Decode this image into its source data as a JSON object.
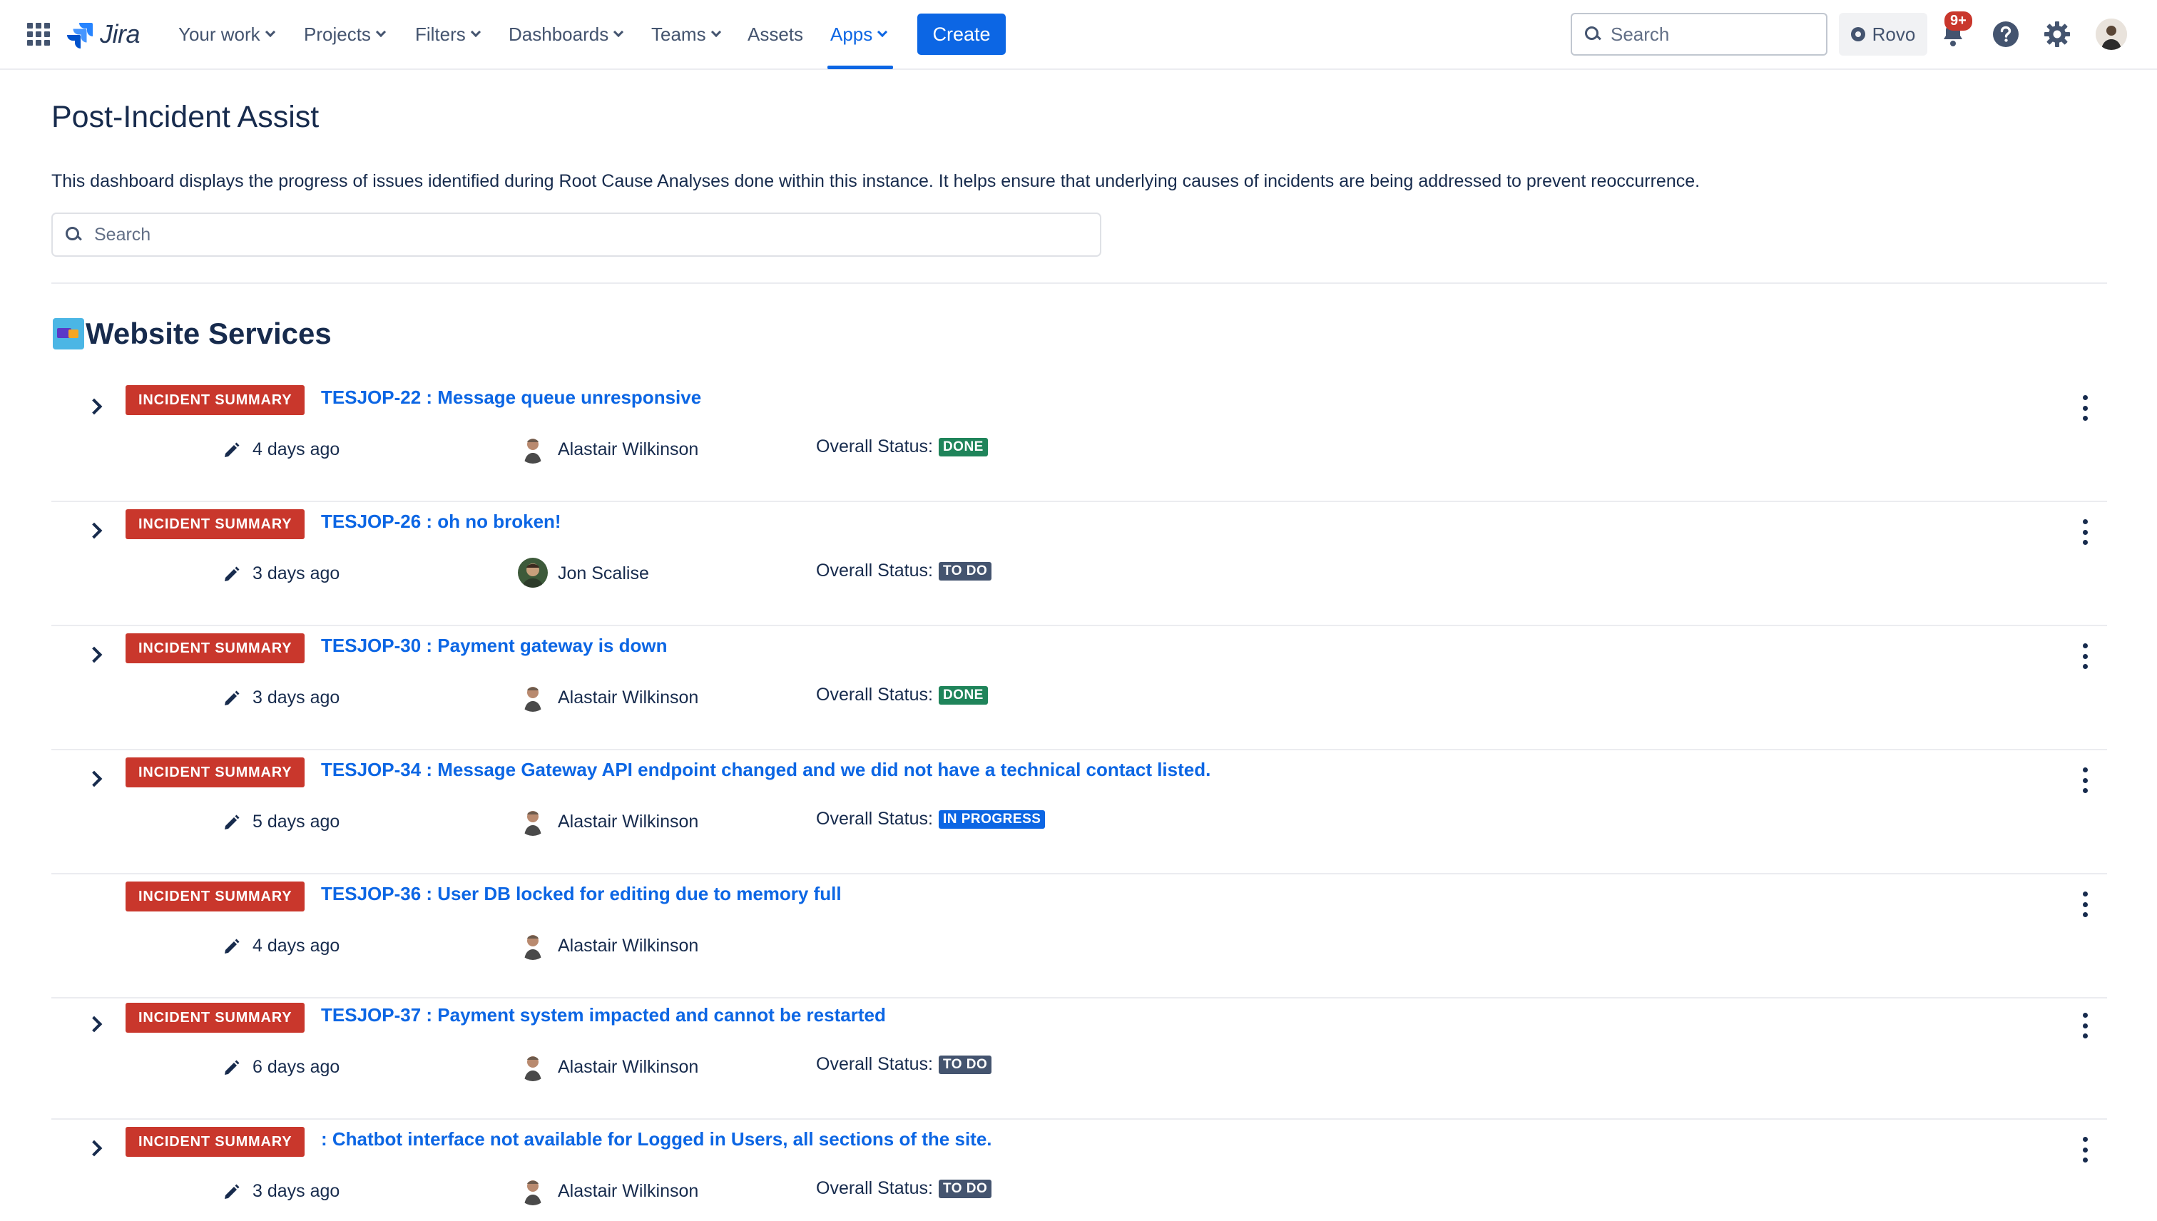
{
  "nav": {
    "logo_text": "Jira",
    "items": [
      {
        "label": "Your work",
        "has_chevron": true
      },
      {
        "label": "Projects",
        "has_chevron": true
      },
      {
        "label": "Filters",
        "has_chevron": true
      },
      {
        "label": "Dashboards",
        "has_chevron": true
      },
      {
        "label": "Teams",
        "has_chevron": true
      },
      {
        "label": "Assets",
        "has_chevron": false
      },
      {
        "label": "Apps",
        "has_chevron": true,
        "active": true
      }
    ],
    "create_label": "Create",
    "search_placeholder": "Search",
    "rovo_label": "Rovo",
    "notifications_badge": "9+",
    "accent_color": "#0c66e4"
  },
  "page": {
    "title": "Post-Incident Assist",
    "description": "This dashboard displays the progress of issues identified during Root Cause Analyses done within this instance. It helps ensure that underlying causes of incidents are being addressed to prevent reoccurrence.",
    "search_placeholder": "Search"
  },
  "section": {
    "title": "Website Services",
    "status_prefix": "Overall Status:",
    "lozenge_label": "INCIDENT SUMMARY",
    "lozenge_color": "#c9372c"
  },
  "incidents": [
    {
      "key_title": "TESJOP-22 : Message queue unresponsive",
      "updated": "4 days ago",
      "person": "Alastair Wilkinson",
      "status": "DONE",
      "expandable": true
    },
    {
      "key_title": "TESJOP-26 : oh no broken!",
      "updated": "3 days ago",
      "person": "Jon Scalise",
      "status": "TO DO",
      "expandable": true
    },
    {
      "key_title": "TESJOP-30 : Payment gateway is down",
      "updated": "3 days ago",
      "person": "Alastair Wilkinson",
      "status": "DONE",
      "expandable": true
    },
    {
      "key_title": "TESJOP-34 : Message Gateway API endpoint changed and we did not have a technical contact listed.",
      "updated": "5 days ago",
      "person": "Alastair Wilkinson",
      "status": "IN PROGRESS",
      "expandable": true
    },
    {
      "key_title": "TESJOP-36 : User DB locked for editing due to memory full",
      "updated": "4 days ago",
      "person": "Alastair Wilkinson",
      "status": "",
      "expandable": false
    },
    {
      "key_title": "TESJOP-37 : Payment system impacted and cannot be restarted",
      "updated": "6 days ago",
      "person": "Alastair Wilkinson",
      "status": "TO DO",
      "expandable": true
    },
    {
      "key_title": ": Chatbot interface not available for Logged in Users, all sections of the site.",
      "updated": "3 days ago",
      "person": "Alastair Wilkinson",
      "status": "TO DO",
      "expandable": true
    }
  ]
}
